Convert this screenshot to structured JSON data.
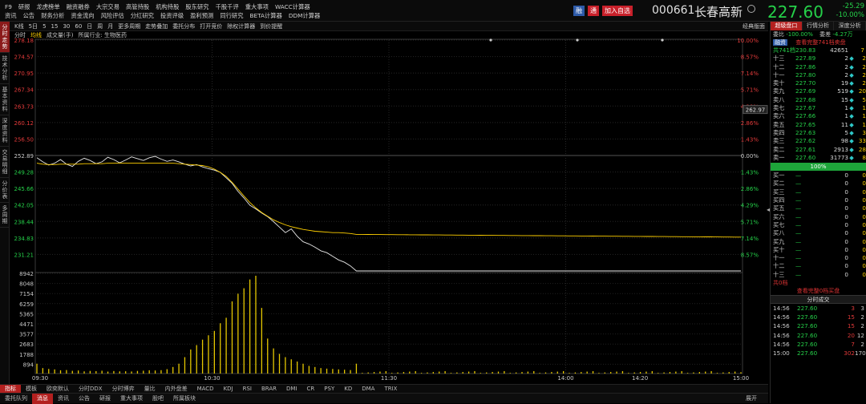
{
  "menu": {
    "row1": [
      "F9",
      "研报",
      "龙虎榜单",
      "融资融券",
      "大宗交易",
      "高管持股",
      "机构持股",
      "股东研究",
      "千股千评",
      "重大事项",
      "WACC计算器"
    ],
    "row2": [
      "资讯",
      "公告",
      "财务分析",
      "资金流向",
      "风险评估",
      "分红研究",
      "投资评级",
      "盈利预测",
      "同行研究",
      "BETA计算器",
      "DDM计算器"
    ]
  },
  "header": {
    "btn_rong": "融",
    "btn_tong": "通",
    "btn_add": "加入自选",
    "code": "000661",
    "name": "长春高新",
    "price": "227.60",
    "change": "-25.29",
    "change_pct": "-10.00%",
    "price_color": "#25d049"
  },
  "left_tabs": [
    "分时走势",
    "技术分析",
    "基本资料",
    "深度资料",
    "交易明细",
    "分价表",
    "多周期"
  ],
  "toolbar": {
    "items": [
      "K线",
      "5日",
      "5",
      "15",
      "30",
      "60",
      "日",
      "周",
      "月",
      "更多周期",
      "走势叠加",
      "委托分布",
      "打开竞价",
      "除权计算器",
      "到价提醒"
    ],
    "right": "经典版面"
  },
  "subbar": {
    "items": [
      "分时",
      "均线",
      "成交量(手)",
      "所属行业: 生物医药"
    ]
  },
  "chart_data": {
    "type": "line",
    "title": "",
    "prev_close": 252.89,
    "price_ticks_left": [
      "278.18",
      "274.57",
      "270.95",
      "267.34",
      "263.73",
      "260.12",
      "256.50",
      "252.89",
      "249.28",
      "245.66",
      "242.05",
      "238.44",
      "234.83",
      "231.21"
    ],
    "pct_ticks_right": [
      "10.00%",
      "8.57%",
      "7.14%",
      "5.71%",
      "4.28%",
      "2.86%",
      "1.43%",
      "0.00%",
      "1.43%",
      "2.86%",
      "4.29%",
      "5.71%",
      "7.14%",
      "8.57%"
    ],
    "volume_ticks": [
      "8942",
      "8048",
      "7154",
      "6259",
      "5365",
      "4471",
      "3577",
      "2683",
      "1788",
      "894"
    ],
    "time_ticks": [
      "09:30",
      "10:30",
      "11:30",
      "14:00",
      "14:20",
      "15:00"
    ],
    "current_label": "262.97",
    "limit_line_label": "8942",
    "price_series": [
      252.4,
      251.5,
      250.8,
      251.2,
      252.0,
      251.0,
      250.5,
      251.6,
      252.3,
      251.8,
      251.1,
      251.5,
      252.5,
      252.0,
      251.3,
      251.9,
      252.6,
      252.2,
      251.8,
      252.4,
      252.7,
      252.1,
      251.6,
      251.9,
      251.5,
      251.0,
      250.6,
      250.9,
      250.4,
      250.0,
      249.7,
      249.2,
      248.0,
      246.8,
      245.0,
      243.6,
      242.0,
      241.2,
      240.3,
      239.5,
      238.4,
      237.2,
      236.0,
      236.8,
      235.2,
      234.0,
      233.5,
      232.8,
      232.0,
      231.6,
      230.8,
      230.0,
      229.5,
      228.7,
      227.6
    ],
    "avg_series": [
      251.2,
      251.0,
      250.9,
      250.9,
      251.0,
      251.0,
      251.0,
      251.0,
      251.1,
      251.1,
      251.1,
      251.1,
      251.2,
      251.2,
      251.2,
      251.2,
      251.2,
      251.2,
      251.2,
      251.2,
      251.2,
      251.2,
      251.2,
      251.2,
      251.1,
      251.0,
      250.9,
      250.8,
      250.7,
      250.4,
      249.9,
      249.2,
      248.3,
      247.0,
      245.5,
      244.0,
      242.6,
      241.4,
      240.4,
      239.6,
      238.8,
      238.2,
      237.7,
      237.3,
      237.0,
      236.7,
      236.5,
      236.3,
      236.2,
      236.1,
      236.0,
      236.0,
      235.9,
      235.8,
      235.6
    ],
    "volume_series": [
      900,
      500,
      420,
      380,
      300,
      320,
      250,
      280,
      200,
      240,
      220,
      260,
      180,
      230,
      200,
      210,
      190,
      240,
      260,
      300,
      280,
      310,
      400,
      600,
      900,
      1500,
      2200,
      2600,
      3100,
      3500,
      3900,
      4600,
      5100,
      6600,
      7300,
      7800,
      8600,
      8942,
      6000,
      3200,
      2300,
      1800,
      1500,
      1300,
      1100,
      900,
      700,
      600,
      500,
      450,
      420,
      380,
      350,
      320,
      900
    ]
  },
  "right_panel": {
    "tabs": [
      "超级盘口",
      "行情分析",
      "深度分析"
    ],
    "weibi_label": "委比",
    "weibi_value": "-100.00%",
    "weicha_label": "委差",
    "weicha_value": "-4.27万",
    "badge": "融资",
    "link": "查看完整741档卖盘",
    "total_label": "共741档230.83",
    "total_vol": "42651",
    "total_cnt": "7",
    "asks": [
      {
        "label": "十三",
        "price": "227.89",
        "vol": "2",
        "cnt": "2"
      },
      {
        "label": "十二",
        "price": "227.86",
        "vol": "2",
        "cnt": "2"
      },
      {
        "label": "十一",
        "price": "227.80",
        "vol": "2",
        "cnt": "2"
      },
      {
        "label": "卖十",
        "price": "227.70",
        "vol": "19",
        "cnt": "2"
      },
      {
        "label": "卖九",
        "price": "227.69",
        "vol": "519",
        "cnt": "20"
      },
      {
        "label": "卖八",
        "price": "227.68",
        "vol": "15",
        "cnt": "5"
      },
      {
        "label": "卖七",
        "price": "227.67",
        "vol": "1",
        "cnt": "1"
      },
      {
        "label": "卖六",
        "price": "227.66",
        "vol": "1",
        "cnt": "1"
      },
      {
        "label": "卖五",
        "price": "227.65",
        "vol": "11",
        "cnt": "1"
      },
      {
        "label": "卖四",
        "price": "227.63",
        "vol": "5",
        "cnt": "3"
      },
      {
        "label": "卖三",
        "price": "227.62",
        "vol": "98",
        "cnt": "33"
      },
      {
        "label": "卖二",
        "price": "227.61",
        "vol": "2913",
        "cnt": "28"
      },
      {
        "label": "卖一",
        "price": "227.60",
        "vol": "31773",
        "cnt": "8"
      }
    ],
    "pct": "100%",
    "bids": [
      {
        "label": "买一",
        "price": "—",
        "vol": "0",
        "cnt": "0"
      },
      {
        "label": "买二",
        "price": "—",
        "vol": "0",
        "cnt": "0"
      },
      {
        "label": "买三",
        "price": "—",
        "vol": "0",
        "cnt": "0"
      },
      {
        "label": "买四",
        "price": "—",
        "vol": "0",
        "cnt": "0"
      },
      {
        "label": "买五",
        "price": "—",
        "vol": "0",
        "cnt": "0"
      },
      {
        "label": "买六",
        "price": "—",
        "vol": "0",
        "cnt": "0"
      },
      {
        "label": "买七",
        "price": "—",
        "vol": "0",
        "cnt": "0"
      },
      {
        "label": "买八",
        "price": "—",
        "vol": "0",
        "cnt": "0"
      },
      {
        "label": "买九",
        "price": "—",
        "vol": "0",
        "cnt": "0"
      },
      {
        "label": "买十",
        "price": "—",
        "vol": "0",
        "cnt": "0"
      },
      {
        "label": "十一",
        "price": "—",
        "vol": "0",
        "cnt": "0"
      },
      {
        "label": "十二",
        "price": "—",
        "vol": "0",
        "cnt": "0"
      },
      {
        "label": "十三",
        "price": "—",
        "vol": "0",
        "cnt": "0"
      }
    ],
    "bid_total": "共0档",
    "bid_link": "查看完整0档买盘",
    "ticks_title": "分时成交",
    "ticks": [
      {
        "t": "14:56",
        "p": "227.60",
        "v": "3",
        "n": "3"
      },
      {
        "t": "14:56",
        "p": "227.60",
        "v": "15",
        "n": "2"
      },
      {
        "t": "14:56",
        "p": "227.60",
        "v": "15",
        "n": "2"
      },
      {
        "t": "14:56",
        "p": "227.60",
        "v": "20",
        "n": "12"
      },
      {
        "t": "14:56",
        "p": "227.60",
        "v": "7",
        "n": "2"
      },
      {
        "t": "15:00",
        "p": "227.60",
        "v": "302",
        "n": "170"
      }
    ]
  },
  "bottom_tabs": [
    "指标",
    "模板",
    "欧奕默认",
    "分时DDX",
    "分时博弈",
    "量比",
    "内外盘差",
    "MACD",
    "KDJ",
    "RSI",
    "BRAR",
    "DMI",
    "CR",
    "PSY",
    "KD",
    "DMA",
    "TRIX"
  ],
  "footer_tabs": [
    "委托队列",
    "消息",
    "资讯",
    "公告",
    "研报",
    "重大事项",
    "股吧",
    "所属板块"
  ],
  "footer_right": "展开"
}
